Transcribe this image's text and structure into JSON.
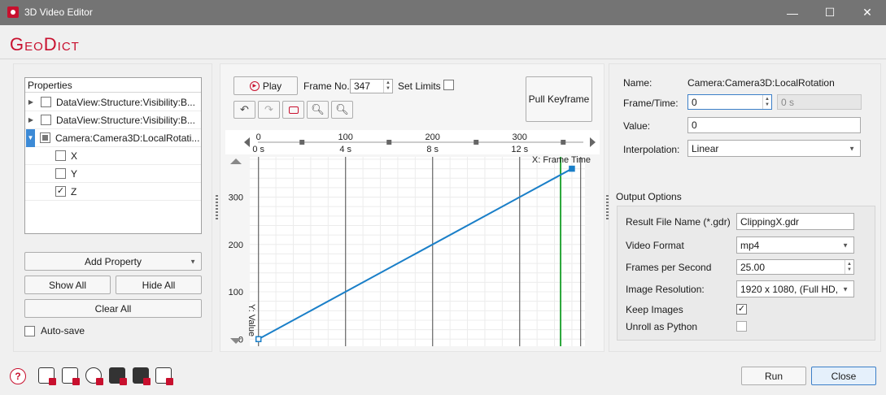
{
  "window": {
    "title": "3D Video Editor",
    "minimize_glyph": "—",
    "maximize_glyph": "☐",
    "close_glyph": "✕"
  },
  "logo": "GeoDict",
  "properties": {
    "header": "Properties",
    "items": [
      {
        "label": "DataView:Structure:Visibility:B...",
        "arrow": "▶",
        "checked": false
      },
      {
        "label": "DataView:Structure:Visibility:B...",
        "arrow": "▶",
        "checked": false
      },
      {
        "label": "Camera:Camera3D:LocalRotati...",
        "arrow": "▼",
        "checked": "partial"
      },
      {
        "label": "X",
        "checked": false
      },
      {
        "label": "Y",
        "checked": false
      },
      {
        "label": "Z",
        "checked": true
      }
    ],
    "add_property": "Add Property",
    "show_all": "Show All",
    "hide_all": "Hide All",
    "clear_all": "Clear All",
    "auto_save": "Auto-save"
  },
  "player": {
    "play_label": "Play",
    "frame_no_label": "Frame No.",
    "frame_no_value": "347",
    "set_limits_label": "Set Limits",
    "pull_keyframe": "Pull Keyframe"
  },
  "icons": {
    "undo": "undo-icon",
    "redo": "redo-icon",
    "fit": "fit-view-icon",
    "zoom_in": "zoom-in-icon",
    "zoom_out": "zoom-out-icon",
    "help": "help-icon"
  },
  "timeline": {
    "frame_ticks": [
      "0",
      "100",
      "200",
      "300"
    ],
    "time_ticks": [
      "0 s",
      "4 s",
      "8 s",
      "12 s"
    ],
    "x_axis_label": "X: Frame Time",
    "y_axis_label": "Y: Value"
  },
  "chart_data": {
    "type": "line",
    "xlabel": "X: Frame Time",
    "ylabel": "Y: Value",
    "xlim": [
      -10,
      375
    ],
    "ylim": [
      -15,
      385
    ],
    "y_ticks": [
      0,
      100,
      200,
      300
    ],
    "x_ticks": [
      0,
      100,
      200,
      300
    ],
    "series": [
      {
        "x": [
          0,
          360
        ],
        "y": [
          0,
          360
        ]
      }
    ],
    "keyframes": [
      0,
      360
    ],
    "current_frame": 347,
    "grid": true
  },
  "keyframe_props": {
    "name_label": "Name:",
    "name_value": "Camera:Camera3D:LocalRotation",
    "frame_time_label": "Frame/Time:",
    "frame_value": "0",
    "time_value": "0 s",
    "value_label": "Value:",
    "value_value": "0",
    "interpolation_label": "Interpolation:",
    "interpolation_value": "Linear"
  },
  "output": {
    "title": "Output Options",
    "result_file_label": "Result File Name (*.gdr)",
    "result_file_value": "ClippingX.gdr",
    "video_format_label": "Video Format",
    "video_format_value": "mp4",
    "fps_label": "Frames per Second",
    "fps_value": "25.00",
    "resolution_label": "Image Resolution:",
    "resolution_value": "1920 x 1080, (Full HD,",
    "keep_images_label": "Keep Images",
    "keep_images": true,
    "unroll_label": "Unroll as Python",
    "unroll": false
  },
  "footer": {
    "help_glyph": "?",
    "run": "Run",
    "close": "Close",
    "tool_icons": [
      "load-macro-icon",
      "save-macro-icon",
      "refresh-icon",
      "settings-save-icon",
      "settings-load-icon",
      "export-icon"
    ]
  }
}
